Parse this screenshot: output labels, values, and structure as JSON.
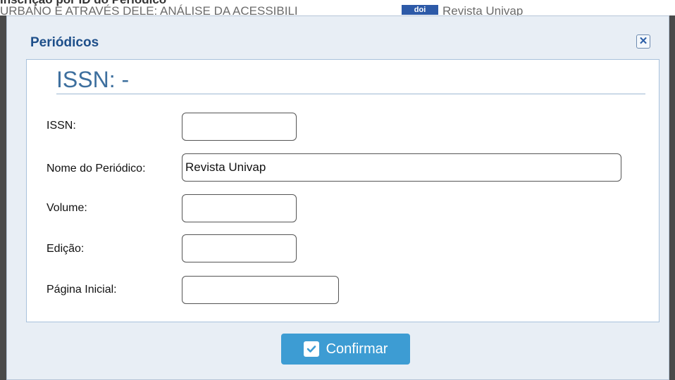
{
  "background": {
    "line1": "Inscrição por ID do Periódico",
    "line2": "URBANO E ATRAVÉS DELE: ANÁLISE DA ACESSIBILI",
    "doi_badge": "doi",
    "line3": "Revista Univap"
  },
  "dialog": {
    "title": "Periódicos",
    "close_icon": "close-icon",
    "header": "ISSN: -"
  },
  "form": {
    "issn": {
      "label": "ISSN:",
      "value": ""
    },
    "nome": {
      "label": "Nome do Periódico:",
      "value": "Revista Univap"
    },
    "volume": {
      "label": "Volume:",
      "value": ""
    },
    "edicao": {
      "label": "Edição:",
      "value": ""
    },
    "pagina": {
      "label": "Página Inicial:",
      "value": ""
    }
  },
  "confirm": {
    "label": "Confirmar",
    "icon": "check-icon"
  },
  "colors": {
    "accent": "#3d9cd3",
    "title": "#1e4f8a",
    "header": "#3d6f9e"
  }
}
